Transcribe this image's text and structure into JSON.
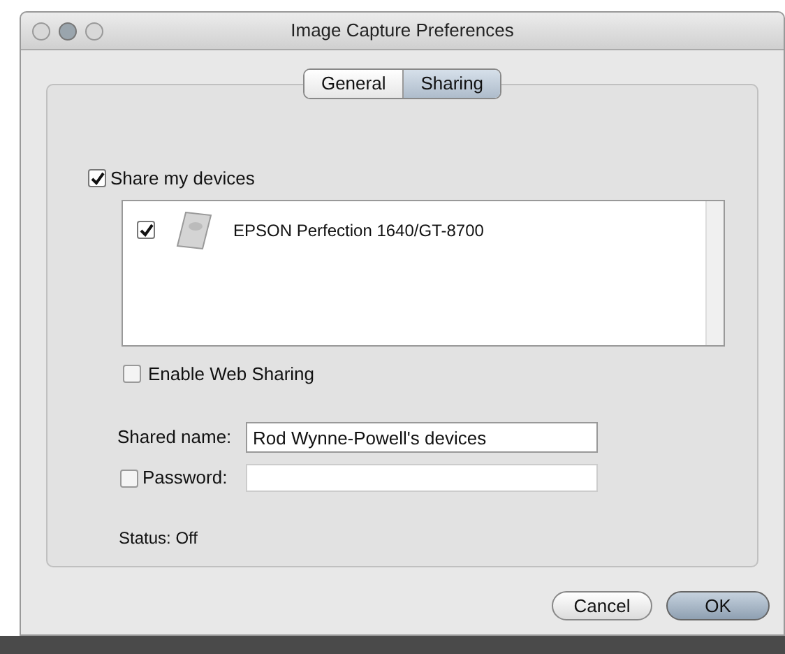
{
  "window": {
    "title": "Image Capture Preferences"
  },
  "tabs": [
    {
      "label": "General",
      "selected": false
    },
    {
      "label": "Sharing",
      "selected": true
    }
  ],
  "share_devices": {
    "label": "Share my devices",
    "checked": true
  },
  "devices": [
    {
      "name": "EPSON Perfection 1640/GT-8700",
      "checked": true
    }
  ],
  "web_sharing": {
    "label": "Enable Web Sharing",
    "checked": false
  },
  "shared_name": {
    "label": "Shared name:",
    "value": "Rod Wynne-Powell's devices"
  },
  "password": {
    "label": "Password:",
    "checked": false
  },
  "status": "Status:  Off",
  "buttons": [
    {
      "label": "Cancel",
      "default": false
    },
    {
      "label": "OK",
      "default": true
    }
  ]
}
